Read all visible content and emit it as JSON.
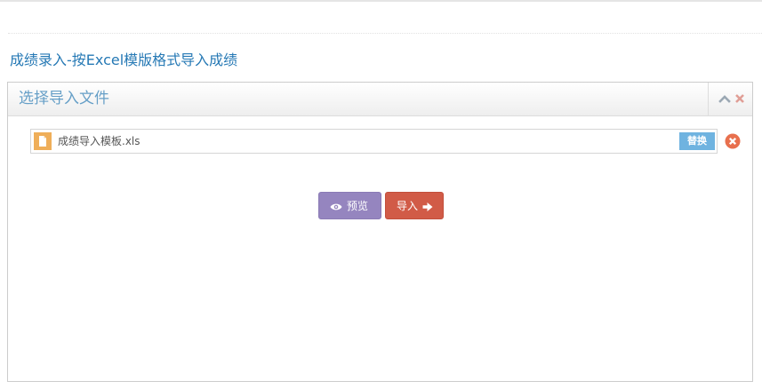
{
  "page": {
    "title": "成绩录入-按Excel模版格式导入成绩"
  },
  "widget": {
    "title": "选择导入文件",
    "toolbar": {
      "collapse_icon": "chevron-up-icon",
      "close_icon": "close-icon"
    }
  },
  "file_input": {
    "file_icon": "file-icon",
    "file_name": "成绩导入模板.xls",
    "replace_label": "替换",
    "remove_icon": "remove-circle-icon"
  },
  "actions": {
    "preview_label": "预览",
    "preview_icon": "eye-icon",
    "import_label": "导入",
    "import_icon": "arrow-right-icon"
  },
  "colors": {
    "title": "#2679b5",
    "widget_title": "#669fc7",
    "replace_button": "#6fb3e0",
    "preview_button": "#9585bf",
    "import_button": "#d15b47",
    "remove_icon": "#e8704e",
    "file_icon": "#efae59"
  }
}
